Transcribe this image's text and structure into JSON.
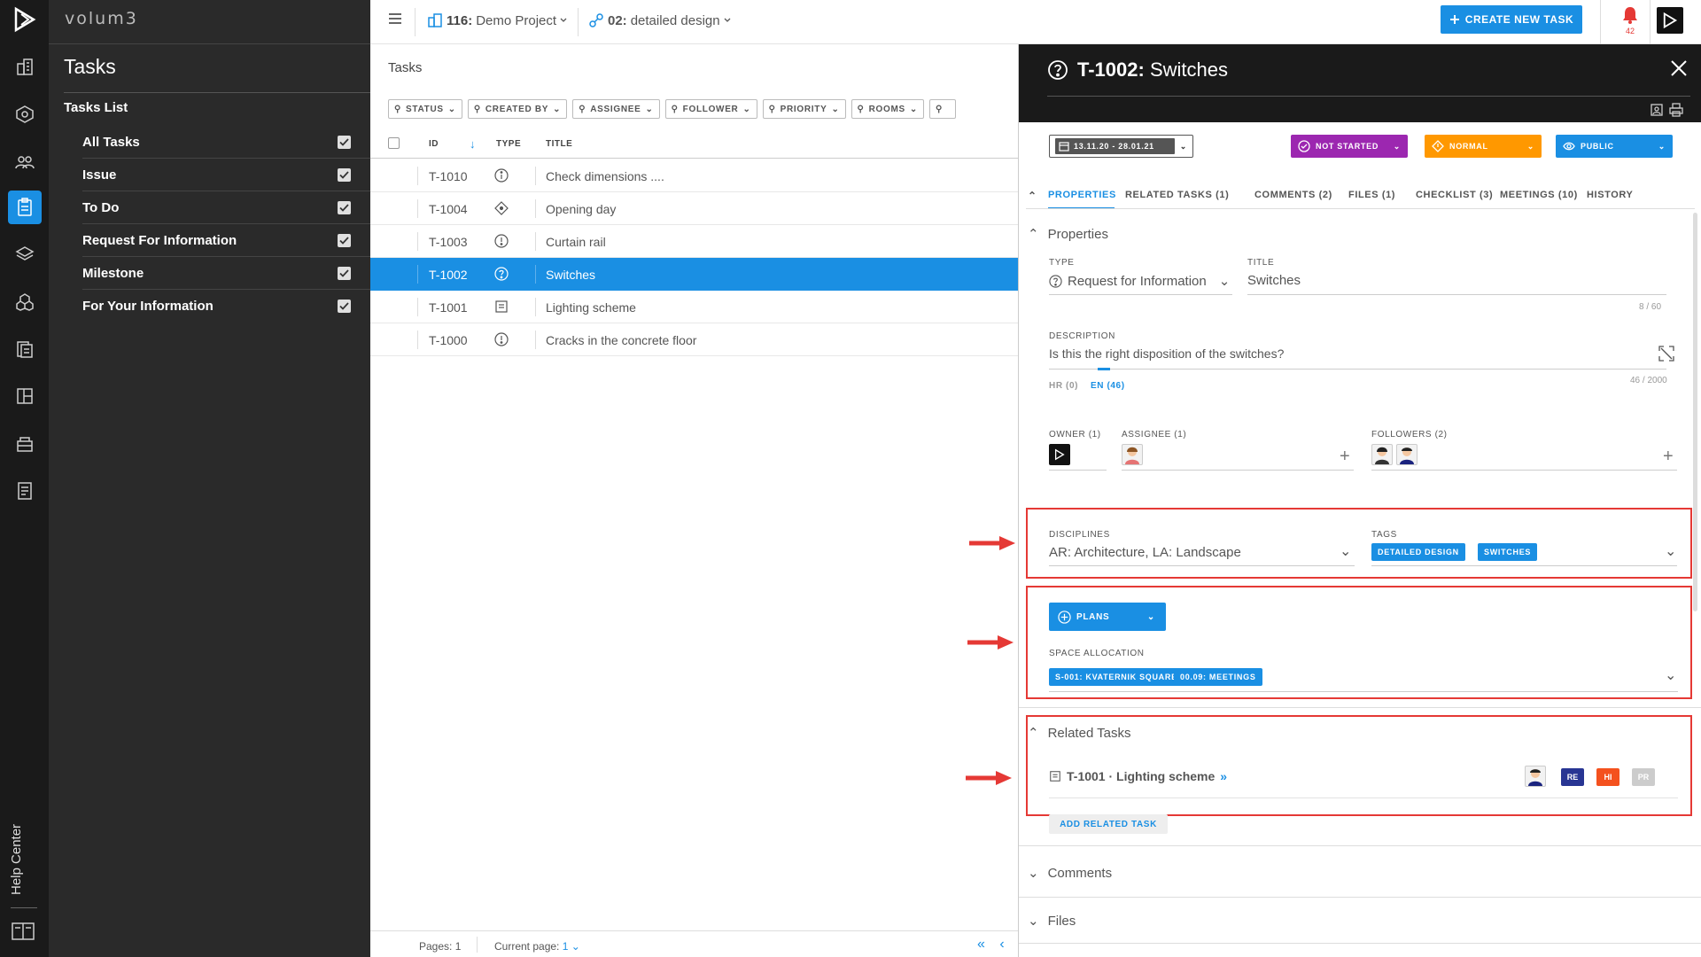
{
  "app": {
    "brand": "volum3",
    "help_center": "Help Center"
  },
  "sidebar": {
    "title": "Tasks",
    "subtitle": "Tasks List",
    "items": [
      {
        "label": "All Tasks",
        "checked": true
      },
      {
        "label": "Issue",
        "checked": true
      },
      {
        "label": "To Do",
        "checked": true
      },
      {
        "label": "Request For Information",
        "checked": true
      },
      {
        "label": "Milestone",
        "checked": true
      },
      {
        "label": "For Your Information",
        "checked": true
      }
    ]
  },
  "topbar": {
    "project_id": "116:",
    "project_name": "Demo Project",
    "phase_id": "02:",
    "phase_name": "detailed design",
    "create_label": "CREATE NEW TASK",
    "notifications": "42"
  },
  "tasks": {
    "header": "Tasks",
    "filters": [
      "STATUS",
      "CREATED BY",
      "ASSIGNEE",
      "FOLLOWER",
      "PRIORITY",
      "ROOMS"
    ],
    "columns": {
      "id": "ID",
      "type": "TYPE",
      "title": "TITLE"
    },
    "rows": [
      {
        "id": "T-1010",
        "type_icon": "info-icon",
        "title": "Check dimensions ....",
        "selected": false
      },
      {
        "id": "T-1004",
        "type_icon": "milestone-icon",
        "title": "Opening day",
        "selected": false
      },
      {
        "id": "T-1003",
        "type_icon": "issue-icon",
        "title": "Curtain rail",
        "selected": false
      },
      {
        "id": "T-1002",
        "type_icon": "question-icon",
        "title": "Switches",
        "selected": true
      },
      {
        "id": "T-1001",
        "type_icon": "todo-icon",
        "title": "Lighting scheme",
        "selected": false
      },
      {
        "id": "T-1000",
        "type_icon": "issue-icon",
        "title": "Cracks in the concrete floor",
        "selected": false
      }
    ],
    "pager": {
      "pages_label": "Pages: 1",
      "current_label": "Current page:",
      "current_value": "1"
    }
  },
  "detail": {
    "task_id": "T-1002:",
    "task_title": "Switches",
    "date_range": "13.11.20 - 28.01.21",
    "status": "NOT STARTED",
    "priority": "NORMAL",
    "visibility": "PUBLIC",
    "colors": {
      "status": "#9c27b0",
      "priority": "#ff9800",
      "visibility": "#1a8fe3",
      "accent": "#1a8fe3",
      "highlight": "#e53935"
    },
    "tabs": [
      "PROPERTIES",
      "RELATED TASKS (1)",
      "COMMENTS (2)",
      "FILES (1)",
      "CHECKLIST (3)",
      "MEETINGS (10)",
      "HISTORY"
    ],
    "properties": {
      "section": "Properties",
      "type_label": "TYPE",
      "type_value": "Request for Information",
      "title_label": "TITLE",
      "title_value": "Switches",
      "title_count": "8 / 60",
      "description_label": "DESCRIPTION",
      "description_value": "Is this the right disposition of the switches?",
      "desc_count": "46 / 2000",
      "lang_hr": "HR (0)",
      "lang_en": "EN (46)",
      "owner_label": "OWNER (1)",
      "assignee_label": "ASSIGNEE (1)",
      "followers_label": "FOLLOWERS (2)",
      "disciplines_label": "DISCIPLINES",
      "disciplines_value": "AR: Architecture, LA: Landscape",
      "tags_label": "TAGS",
      "tags": [
        "DETAILED DESIGN",
        "SWITCHES"
      ],
      "plans_label": "PLANS",
      "space_label": "SPACE ALLOCATION",
      "spaces": [
        "S-001: KVATERNIK SQUARE",
        "00.09: MEETINGS"
      ]
    },
    "related": {
      "section": "Related Tasks",
      "task_label": "T-1001 · Lighting scheme",
      "badges": [
        {
          "text": "RE",
          "color": "#283593"
        },
        {
          "text": "HI",
          "color": "#f4511e"
        },
        {
          "text": "PR",
          "color": "#cccccc"
        }
      ],
      "add_label": "ADD RELATED TASK"
    },
    "comments_section": "Comments",
    "files_section": "Files"
  }
}
